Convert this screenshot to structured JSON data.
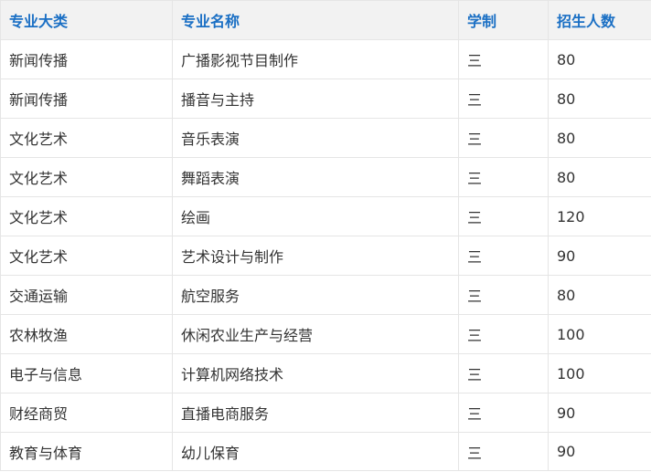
{
  "colors": {
    "header_text": "#1a6fc4",
    "header_background": "#f2f2f2",
    "cell_text": "#333333",
    "border": "#e5e5e5"
  },
  "table": {
    "headers": [
      "专业大类",
      "专业名称",
      "学制",
      "招生人数"
    ],
    "rows": [
      [
        "新闻传播",
        "广播影视节目制作",
        "三",
        "80"
      ],
      [
        "新闻传播",
        "播音与主持",
        "三",
        "80"
      ],
      [
        "文化艺术",
        "音乐表演",
        "三",
        "80"
      ],
      [
        "文化艺术",
        "舞蹈表演",
        "三",
        "80"
      ],
      [
        "文化艺术",
        "绘画",
        "三",
        "120"
      ],
      [
        "文化艺术",
        "艺术设计与制作",
        "三",
        "90"
      ],
      [
        "交通运输",
        "航空服务",
        "三",
        "80"
      ],
      [
        "农林牧渔",
        "休闲农业生产与经营",
        "三",
        "100"
      ],
      [
        "电子与信息",
        "计算机网络技术",
        "三",
        "100"
      ],
      [
        "财经商贸",
        "直播电商服务",
        "三",
        "90"
      ],
      [
        "教育与体育",
        "幼儿保育",
        "三",
        "90"
      ]
    ]
  }
}
